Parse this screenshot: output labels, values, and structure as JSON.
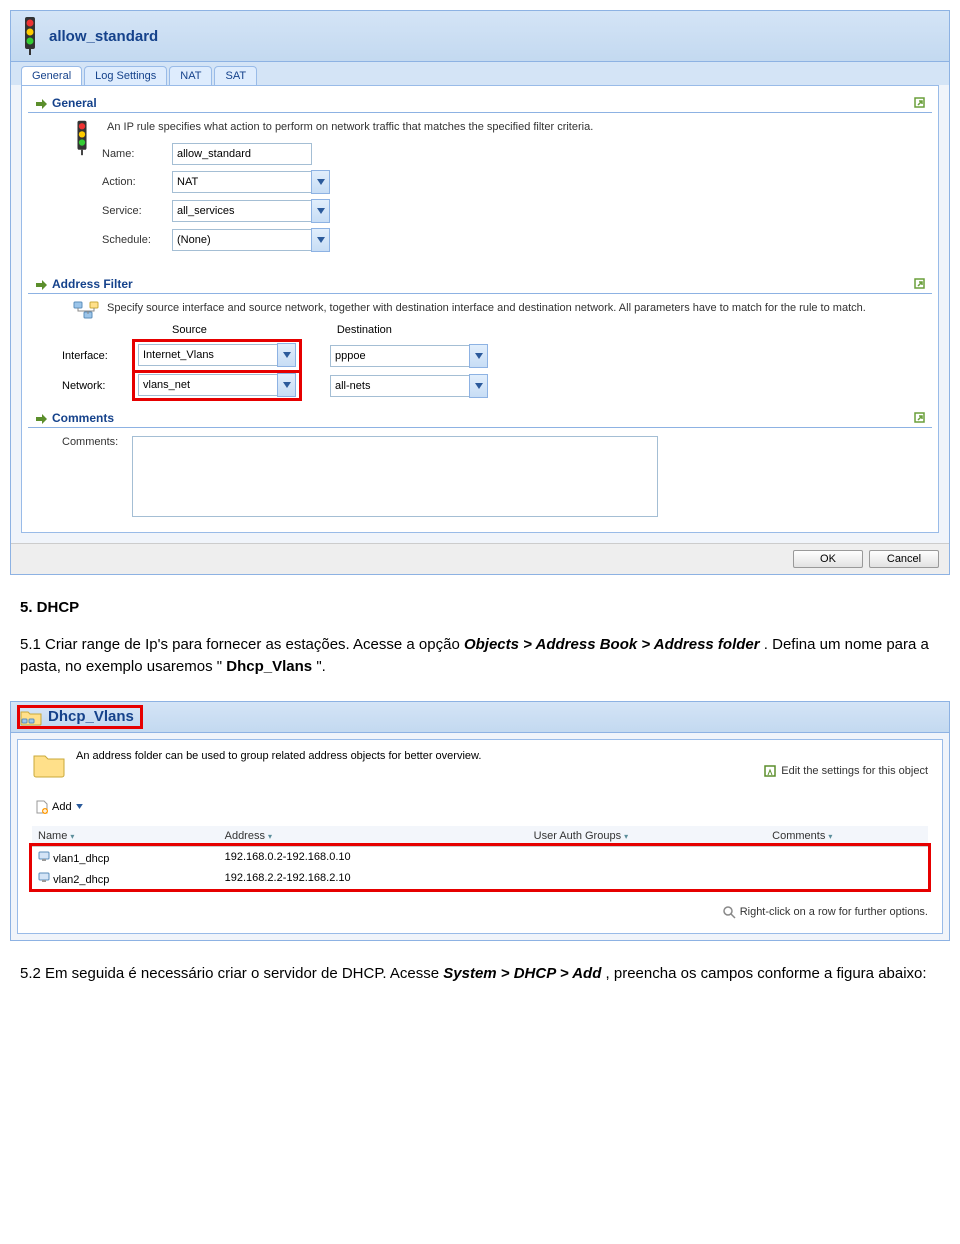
{
  "dialog1": {
    "title": "allow_standard",
    "tabs": [
      "General",
      "Log Settings",
      "NAT",
      "SAT"
    ],
    "sections": {
      "general": {
        "title": "General",
        "desc": "An IP rule specifies what action to perform on network traffic that matches the specified filter criteria.",
        "fields": {
          "name_label": "Name:",
          "name_value": "allow_standard",
          "action_label": "Action:",
          "action_value": "NAT",
          "service_label": "Service:",
          "service_value": "all_services",
          "schedule_label": "Schedule:",
          "schedule_value": "(None)"
        }
      },
      "addrfilter": {
        "title": "Address Filter",
        "desc": "Specify source interface and source network, together with destination interface and destination network. All parameters have to match for the rule to match.",
        "col1": "Source",
        "col2": "Destination",
        "interface_label": "Interface:",
        "interface_src": "Internet_Vlans",
        "interface_dst": "pppoe",
        "network_label": "Network:",
        "network_src": "vlans_net",
        "network_dst": "all-nets"
      },
      "comments": {
        "title": "Comments",
        "label": "Comments:",
        "value": ""
      }
    },
    "buttons": {
      "ok": "OK",
      "cancel": "Cancel"
    }
  },
  "doc1": {
    "heading": "5. DHCP",
    "body_pre": "5.1 Criar range de Ip's para fornecer as estações. Acesse a opção ",
    "body_em": "Objects > Address Book > Address folder",
    "body_mid": ". Defina um nome para a pasta, no exemplo usaremos \"",
    "body_bold": "Dhcp_Vlans",
    "body_post": "\"."
  },
  "dialog2": {
    "title": "Dhcp_Vlans",
    "desc": "An address folder can be used to group related address objects for better overview.",
    "edit_link": "Edit the settings for this object",
    "add_link": "Add",
    "columns": [
      "Name",
      "Address",
      "User Auth Groups",
      "Comments"
    ],
    "rows": [
      {
        "name": "vlan1_dhcp",
        "address": "192.168.0.2-192.168.0.10",
        "groups": "",
        "comments": ""
      },
      {
        "name": "vlan2_dhcp",
        "address": "192.168.2.2-192.168.2.10",
        "groups": "",
        "comments": ""
      }
    ],
    "rightclick": "Right-click on a row for further options."
  },
  "doc2": {
    "pre": "5.2 Em seguida é necessário criar o servidor de DHCP. Acesse ",
    "em": "System > DHCP > Add",
    "post": ", preencha os campos conforme a figura abaixo:"
  }
}
